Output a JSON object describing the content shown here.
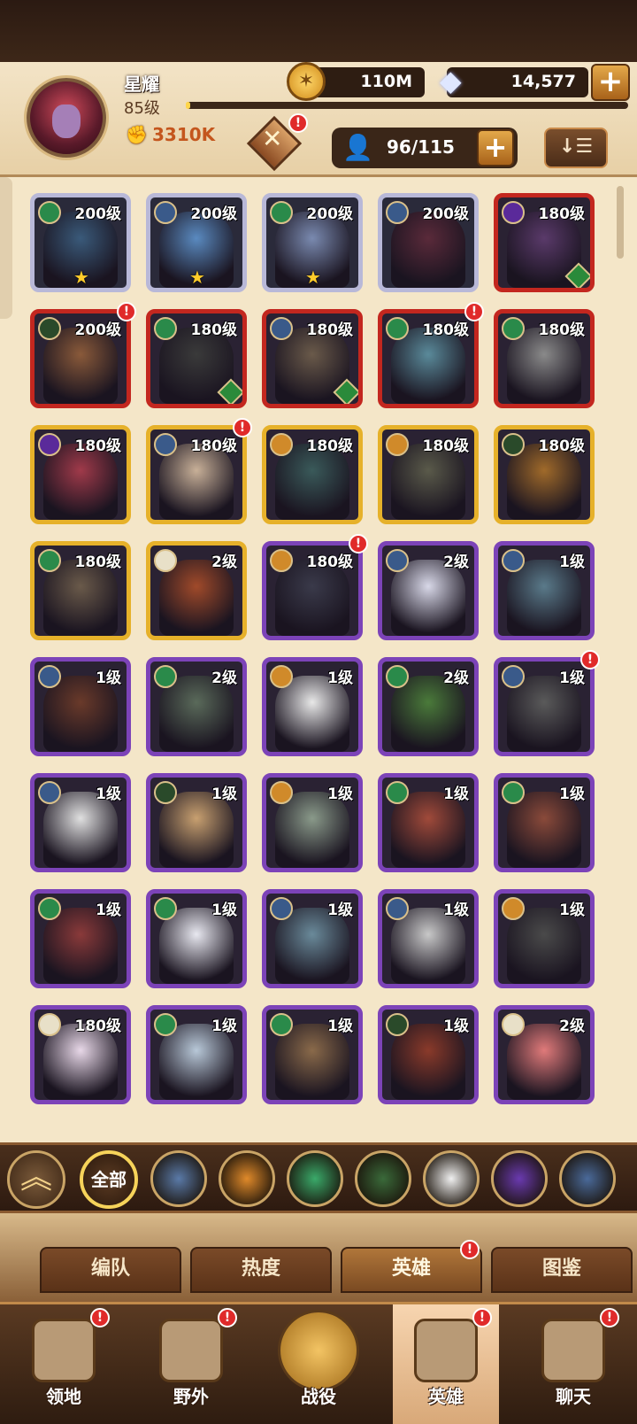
{
  "player": {
    "name": "星耀",
    "level": "85级",
    "power": "3310K",
    "xp_fraction": 0.01
  },
  "currency": {
    "gold": "110M",
    "gems": "14,577",
    "plus": "+"
  },
  "roster": {
    "count": "96/115",
    "plus": "+",
    "sort_icon": "↓☰"
  },
  "quest_badge": "!",
  "heroes": [
    {
      "level": "200级",
      "tier": "mythic",
      "faction": "wilder",
      "stars": 1,
      "color": "#3a5a7a"
    },
    {
      "level": "200级",
      "tier": "mythic",
      "faction": "lightbearer",
      "stars": 1,
      "color": "#5a8ac0"
    },
    {
      "level": "200级",
      "tier": "mythic",
      "faction": "wilder",
      "stars": 1,
      "color": "#7a8ab0"
    },
    {
      "level": "200级",
      "tier": "mythic",
      "faction": "lightbearer",
      "stars": 0,
      "color": "#5a2a3a"
    },
    {
      "level": "180级",
      "tier": "elite",
      "faction": "hypogean",
      "stars": 0,
      "color": "#5a3a6a",
      "hourglass": true
    },
    {
      "level": "200级",
      "tier": "elite",
      "faction": "graveborn",
      "stars": 0,
      "color": "#8a5a3a",
      "badge": true
    },
    {
      "level": "180级",
      "tier": "elite",
      "faction": "wilder",
      "stars": 0,
      "color": "#3a3a3a",
      "hourglass": true
    },
    {
      "level": "180级",
      "tier": "elite",
      "faction": "lightbearer",
      "stars": 0,
      "color": "#6a5a4a",
      "hourglass": true
    },
    {
      "level": "180级",
      "tier": "elite",
      "faction": "wilder",
      "stars": 0,
      "color": "#5a8a9a",
      "badge": true
    },
    {
      "level": "180级",
      "tier": "elite",
      "faction": "wilder",
      "stars": 0,
      "color": "#8a8a8a"
    },
    {
      "level": "180级",
      "tier": "legend",
      "faction": "hypogean",
      "stars": 0,
      "color": "#a03a4a"
    },
    {
      "level": "180级",
      "tier": "legend",
      "faction": "lightbearer",
      "stars": 0,
      "color": "#c8b098",
      "badge": true
    },
    {
      "level": "180级",
      "tier": "legend",
      "faction": "mauler",
      "stars": 0,
      "color": "#3a5a5a"
    },
    {
      "level": "180级",
      "tier": "legend",
      "faction": "mauler",
      "stars": 0,
      "color": "#5a5a4a"
    },
    {
      "level": "180级",
      "tier": "legend",
      "faction": "graveborn",
      "stars": 0,
      "color": "#a06a2a"
    },
    {
      "level": "180级",
      "tier": "legend",
      "faction": "wilder",
      "stars": 0,
      "color": "#6a5a4a"
    },
    {
      "level": "2级",
      "tier": "legend",
      "faction": "celestial",
      "stars": 0,
      "color": "#a04a2a"
    },
    {
      "level": "180级",
      "tier": "rare",
      "faction": "mauler",
      "stars": 0,
      "color": "#3a3a4a",
      "badge": true
    },
    {
      "level": "2级",
      "tier": "rare",
      "faction": "lightbearer",
      "stars": 0,
      "color": "#d8d8e8"
    },
    {
      "level": "1级",
      "tier": "rare",
      "faction": "lightbearer",
      "stars": 0,
      "color": "#5a7a8a"
    },
    {
      "level": "1级",
      "tier": "rare",
      "faction": "lightbearer",
      "stars": 0,
      "color": "#6a3a2a"
    },
    {
      "level": "2级",
      "tier": "rare",
      "faction": "wilder",
      "stars": 0,
      "color": "#5a6a5a"
    },
    {
      "level": "1级",
      "tier": "rare",
      "faction": "mauler",
      "stars": 0,
      "color": "#e8e8e8"
    },
    {
      "level": "2级",
      "tier": "rare",
      "faction": "wilder",
      "stars": 0,
      "color": "#4a7a3a"
    },
    {
      "level": "1级",
      "tier": "rare",
      "faction": "lightbearer",
      "stars": 0,
      "color": "#5a5a5a",
      "badge": true
    },
    {
      "level": "1级",
      "tier": "rare",
      "faction": "lightbearer",
      "stars": 0,
      "color": "#e0e0e0"
    },
    {
      "level": "1级",
      "tier": "rare",
      "faction": "graveborn",
      "stars": 0,
      "color": "#c8a070"
    },
    {
      "level": "1级",
      "tier": "rare",
      "faction": "mauler",
      "stars": 0,
      "color": "#8a9a8a"
    },
    {
      "level": "1级",
      "tier": "rare",
      "faction": "wilder",
      "stars": 0,
      "color": "#a04a3a"
    },
    {
      "level": "1级",
      "tier": "rare",
      "faction": "wilder",
      "stars": 0,
      "color": "#8a4a3a"
    },
    {
      "level": "1级",
      "tier": "rare",
      "faction": "wilder",
      "stars": 0,
      "color": "#8a3a3a"
    },
    {
      "level": "1级",
      "tier": "rare",
      "faction": "wilder",
      "stars": 0,
      "color": "#e8e8f0"
    },
    {
      "level": "1级",
      "tier": "rare",
      "faction": "lightbearer",
      "stars": 0,
      "color": "#6a8a9a"
    },
    {
      "level": "1级",
      "tier": "rare",
      "faction": "lightbearer",
      "stars": 0,
      "color": "#c8c8c8"
    },
    {
      "level": "1级",
      "tier": "rare",
      "faction": "mauler",
      "stars": 0,
      "color": "#4a4a4a"
    },
    {
      "level": "180级",
      "tier": "rare",
      "faction": "celestial",
      "stars": 0,
      "color": "#e8d8e8"
    },
    {
      "level": "1级",
      "tier": "rare",
      "faction": "wilder",
      "stars": 0,
      "color": "#b8c8d8"
    },
    {
      "level": "1级",
      "tier": "rare",
      "faction": "wilder",
      "stars": 0,
      "color": "#8a6a4a"
    },
    {
      "level": "1级",
      "tier": "rare",
      "faction": "graveborn",
      "stars": 0,
      "color": "#8a3a2a"
    },
    {
      "level": "2级",
      "tier": "rare",
      "faction": "celestial",
      "stars": 0,
      "color": "#e07a7a"
    }
  ],
  "faction_filter": {
    "up_icon": "︽",
    "all_label": "全部",
    "factions": [
      {
        "name": "lightbearer",
        "color": "#5a7aa8"
      },
      {
        "name": "mauler",
        "color": "#e08a2a"
      },
      {
        "name": "wilder",
        "color": "#3aaa6a"
      },
      {
        "name": "graveborn",
        "color": "#3a6a3a"
      },
      {
        "name": "celestial",
        "color": "#f0f0f0"
      },
      {
        "name": "hypogean",
        "color": "#6a3ab0"
      },
      {
        "name": "dimensional",
        "color": "#4a6a9a"
      }
    ]
  },
  "sub_tabs": [
    "编队",
    "热度",
    "英雄",
    "图鉴"
  ],
  "sub_tab_active": 2,
  "bottom_nav": [
    {
      "label": "领地",
      "icon": "castle-icon",
      "badge": true
    },
    {
      "label": "野外",
      "icon": "scroll-icon",
      "badge": true
    },
    {
      "label": "战役",
      "icon": "sword-icon",
      "badge": false
    },
    {
      "label": "英雄",
      "icon": "helmet-icon",
      "badge": true
    },
    {
      "label": "聊天",
      "icon": "chat-icon",
      "badge": true
    }
  ],
  "bottom_nav_active": 3
}
